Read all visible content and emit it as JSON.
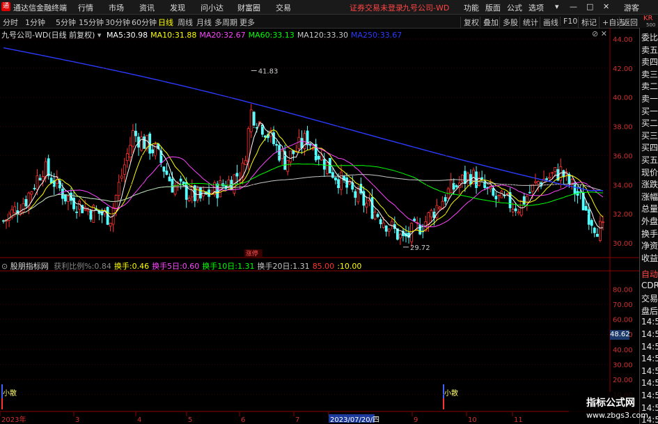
{
  "menubar": {
    "app_title": "通达信金融终端",
    "menus": [
      "行情",
      "市场",
      "资讯",
      "发现",
      "问小达",
      "财富圈",
      "交易"
    ],
    "status": "证券交易未登录",
    "stock_name": "九号公司-WD",
    "right_menus": [
      "功能",
      "版面",
      "公式",
      "选项"
    ],
    "guest": "游客",
    "win_controls": [
      "▾",
      "—",
      "□",
      "✕"
    ]
  },
  "toolbar": {
    "periods": [
      "分时",
      "1分钟",
      "5分钟",
      "15分钟",
      "30分钟",
      "60分钟",
      "日线",
      "周线",
      "月线",
      "多周期",
      "更多"
    ],
    "active_period": "日线",
    "right_buttons": [
      "复权",
      "叠加",
      "多股",
      "统计",
      "画线",
      "F10",
      "标记",
      "+自选",
      "返回"
    ]
  },
  "main_chart": {
    "title": "九号公司-WD(日线 前复权)",
    "ma": [
      {
        "label": "MA5:",
        "value": "30.98",
        "color": "#ffffff"
      },
      {
        "label": "MA10:",
        "value": "31.88",
        "color": "#ffff00"
      },
      {
        "label": "MA20:",
        "value": "32.67",
        "color": "#ff44ff"
      },
      {
        "label": "MA60:",
        "value": "33.13",
        "color": "#00ff00"
      },
      {
        "label": "MA120:",
        "value": "33.30",
        "color": "#c8c8c8"
      },
      {
        "label": "MA250:",
        "value": "33.67",
        "color": "#2b3bff"
      }
    ],
    "y_ticks": [
      "44.00",
      "42.00",
      "40.00",
      "38.00",
      "36.00",
      "34.00",
      "32.00",
      "30.00"
    ],
    "high_label": "41.83",
    "low_label": "29.72",
    "event_tag": "涨停"
  },
  "indicator": {
    "title": "股朋指标网",
    "items": [
      {
        "label": "获利比例%:",
        "value": "0.84",
        "color": "#888888"
      },
      {
        "label": "换手:",
        "value": "0.46",
        "color": "#ffff00"
      },
      {
        "label": "换手5日:",
        "value": "0.60",
        "color": "#ff44ff"
      },
      {
        "label": "换手10日:",
        "value": "1.31",
        "color": "#00ff00"
      },
      {
        "label": "换手20日:",
        "value": "1.31",
        "color": "#c8c8c8"
      },
      {
        "label": "",
        "value": "85.00",
        "color": "#ff3333"
      },
      {
        "label": ":",
        "value": "10.00",
        "color": "#ffff00"
      }
    ],
    "y_ticks": [
      "80.00",
      "70.00",
      "60.00",
      "50.00",
      "40.00",
      "30.00",
      "20.00",
      "10.00"
    ],
    "current_value": "48.62",
    "signal_label": "小散"
  },
  "x_axis": {
    "labels": [
      "2023年",
      "3",
      "4",
      "5",
      "6",
      "7",
      "2023/07/20/四",
      "9",
      "10",
      "11"
    ]
  },
  "right_panel": {
    "top_code": "KR",
    "top_sub": "500",
    "labels": [
      "委比",
      "卖五",
      "卖四",
      "卖三",
      "卖二",
      "卖一",
      "买一",
      "买二",
      "买三",
      "买四",
      "买五",
      "现价",
      "涨跌",
      "涨幅",
      "总量",
      "外盘",
      "换手",
      "净资",
      "收益"
    ],
    "lower_labels": [
      "自动",
      "CDR",
      "交易",
      "盘后",
      "14:56",
      "14:56",
      "14:56",
      "14:56",
      "14:56",
      "14:56",
      "14:56",
      "14:56",
      "14:56"
    ]
  },
  "watermark": {
    "title": "指标公式网",
    "url": "www.zbgs3.com"
  },
  "colors": {
    "up": "#ff3232",
    "down": "#54ffff",
    "ma5": "#ffffff",
    "ma10": "#ffff00",
    "ma20": "#ff44ff",
    "ma60": "#00ff00",
    "ma120": "#c8c8c8",
    "ma250": "#2b3bff",
    "grid": "#8b0000"
  }
}
